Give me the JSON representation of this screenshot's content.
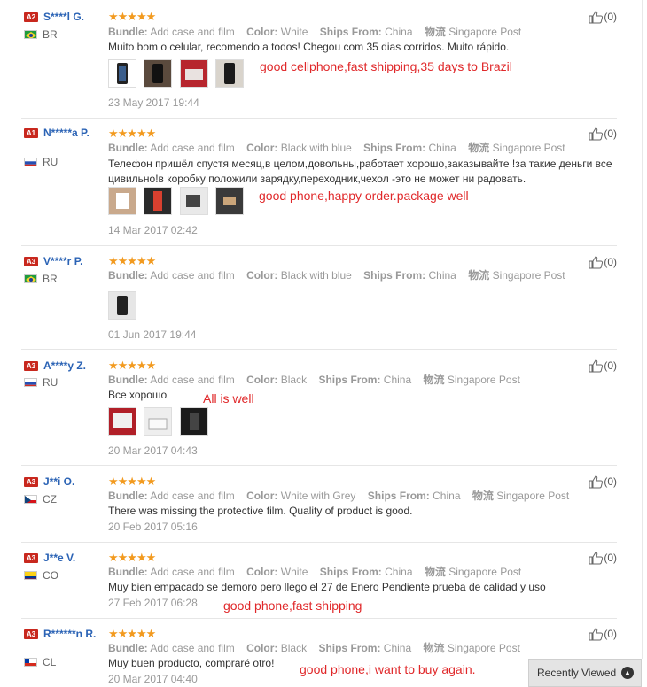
{
  "reviews": [
    {
      "level": "A2",
      "name": "S****l G.",
      "country": "BR",
      "stars": "★★★★★",
      "bundle_label": "Bundle:",
      "bundle": "Add case and film",
      "color_label": "Color:",
      "color": "White",
      "ships_label": "Ships From:",
      "ships": "China",
      "carrier_label": "物流",
      "carrier": "Singapore Post",
      "comment": "Muito bom o celular, recomendo a todos! Chegou com 35 dias corridos. Muito rápido.",
      "note": "good cellphone,fast shipping,35 days to Brazil",
      "date": "23 May 2017 19:44",
      "likes": "(0)"
    },
    {
      "level": "A1",
      "name": "N*****a P.",
      "country": "RU",
      "stars": "★★★★★",
      "bundle_label": "Bundle:",
      "bundle": "Add case and film",
      "color_label": "Color:",
      "color": "Black with blue",
      "ships_label": "Ships From:",
      "ships": "China",
      "carrier_label": "物流",
      "carrier": "Singapore Post",
      "comment": "Телефон пришёл спустя месяц,в целом,довольны,работает хорошо,заказывайте !за такие деньги все цивильно!в коробку положили зарядку,переходник,чехол -это не может ни радовать.",
      "note": "good phone,happy order.package well",
      "date": "14 Mar 2017 02:42",
      "likes": "(0)"
    },
    {
      "level": "A3",
      "name": "V****r P.",
      "country": "BR",
      "stars": "★★★★★",
      "bundle_label": "Bundle:",
      "bundle": "Add case and film",
      "color_label": "Color:",
      "color": "Black with blue",
      "ships_label": "Ships From:",
      "ships": "China",
      "carrier_label": "物流",
      "carrier": "Singapore Post",
      "comment": "",
      "note": "",
      "date": "01 Jun 2017 19:44",
      "likes": "(0)"
    },
    {
      "level": "A3",
      "name": "A****y Z.",
      "country": "RU",
      "stars": "★★★★★",
      "bundle_label": "Bundle:",
      "bundle": "Add case and film",
      "color_label": "Color:",
      "color": "Black",
      "ships_label": "Ships From:",
      "ships": "China",
      "carrier_label": "物流",
      "carrier": "Singapore Post",
      "comment": "Все хорошо",
      "note": "All is well",
      "date": "20 Mar 2017 04:43",
      "likes": "(0)"
    },
    {
      "level": "A3",
      "name": "J**i O.",
      "country": "CZ",
      "stars": "★★★★★",
      "bundle_label": "Bundle:",
      "bundle": "Add case and film",
      "color_label": "Color:",
      "color": "White with Grey",
      "ships_label": "Ships From:",
      "ships": "China",
      "carrier_label": "物流",
      "carrier": "Singapore Post",
      "comment": "There was missing the protective film. Quality of product is good.",
      "note": "",
      "date": "20 Feb 2017 05:16",
      "likes": "(0)"
    },
    {
      "level": "A3",
      "name": "J**e V.",
      "country": "CO",
      "stars": "★★★★★",
      "bundle_label": "Bundle:",
      "bundle": "Add case and film",
      "color_label": "Color:",
      "color": "White",
      "ships_label": "Ships From:",
      "ships": "China",
      "carrier_label": "物流",
      "carrier": "Singapore Post",
      "comment": "Muy bien empacado se demoro pero llego el 27 de Enero Pendiente prueba de calidad y uso",
      "note": "good phone,fast shipping",
      "date": "27 Feb 2017 06:28",
      "likes": "(0)"
    },
    {
      "level": "A3",
      "name": "R******n R.",
      "country": "CL",
      "stars": "★★★★★",
      "bundle_label": "Bundle:",
      "bundle": "Add case and film",
      "color_label": "Color:",
      "color": "Black",
      "ships_label": "Ships From:",
      "ships": "China",
      "carrier_label": "物流",
      "carrier": "Singapore Post",
      "comment": "Muy buen producto, compraré otro!",
      "note": "good phone,i want to buy again.",
      "date": "20 Mar 2017 04:40",
      "likes": "(0)"
    }
  ],
  "recently_viewed": {
    "label": "Recently Viewed",
    "icon": "chevron-up-icon"
  },
  "colors": {
    "name": "#2b63b5",
    "stars": "#f29a1f",
    "note": "#e0282a",
    "badge": "#c8281e"
  }
}
